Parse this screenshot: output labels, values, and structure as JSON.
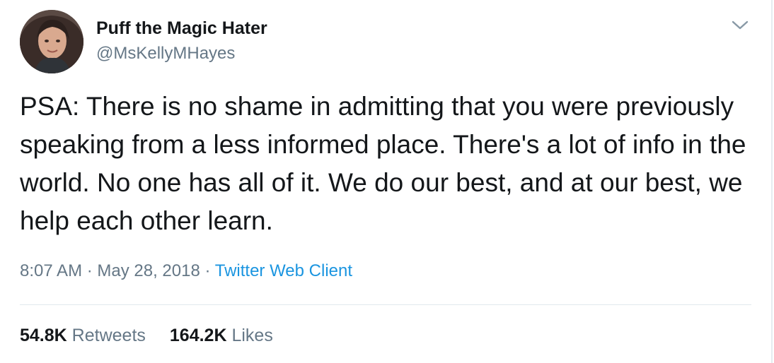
{
  "author": {
    "display_name": "Puff the Magic Hater",
    "handle": "@MsKellyMHayes",
    "avatar_icon": "profile-photo"
  },
  "tweet": {
    "text": "PSA: There is no shame in admitting that you were previously speaking from a less informed place. There's a lot of info in the world. No one has all of it. We do our best, and at our best, we help each other learn.",
    "time": "8:07 AM",
    "separator1": " · ",
    "date": "May 28, 2018",
    "separator2": " · ",
    "source": "Twitter Web Client"
  },
  "stats": {
    "retweets_count": "54.8K",
    "retweets_label": "Retweets",
    "likes_count": "164.2K",
    "likes_label": "Likes"
  },
  "colors": {
    "text_primary": "#14171a",
    "text_secondary": "#657786",
    "link": "#1b95e0",
    "divider": "#e1e8ed"
  },
  "icons": {
    "menu": "chevron-down-icon"
  }
}
